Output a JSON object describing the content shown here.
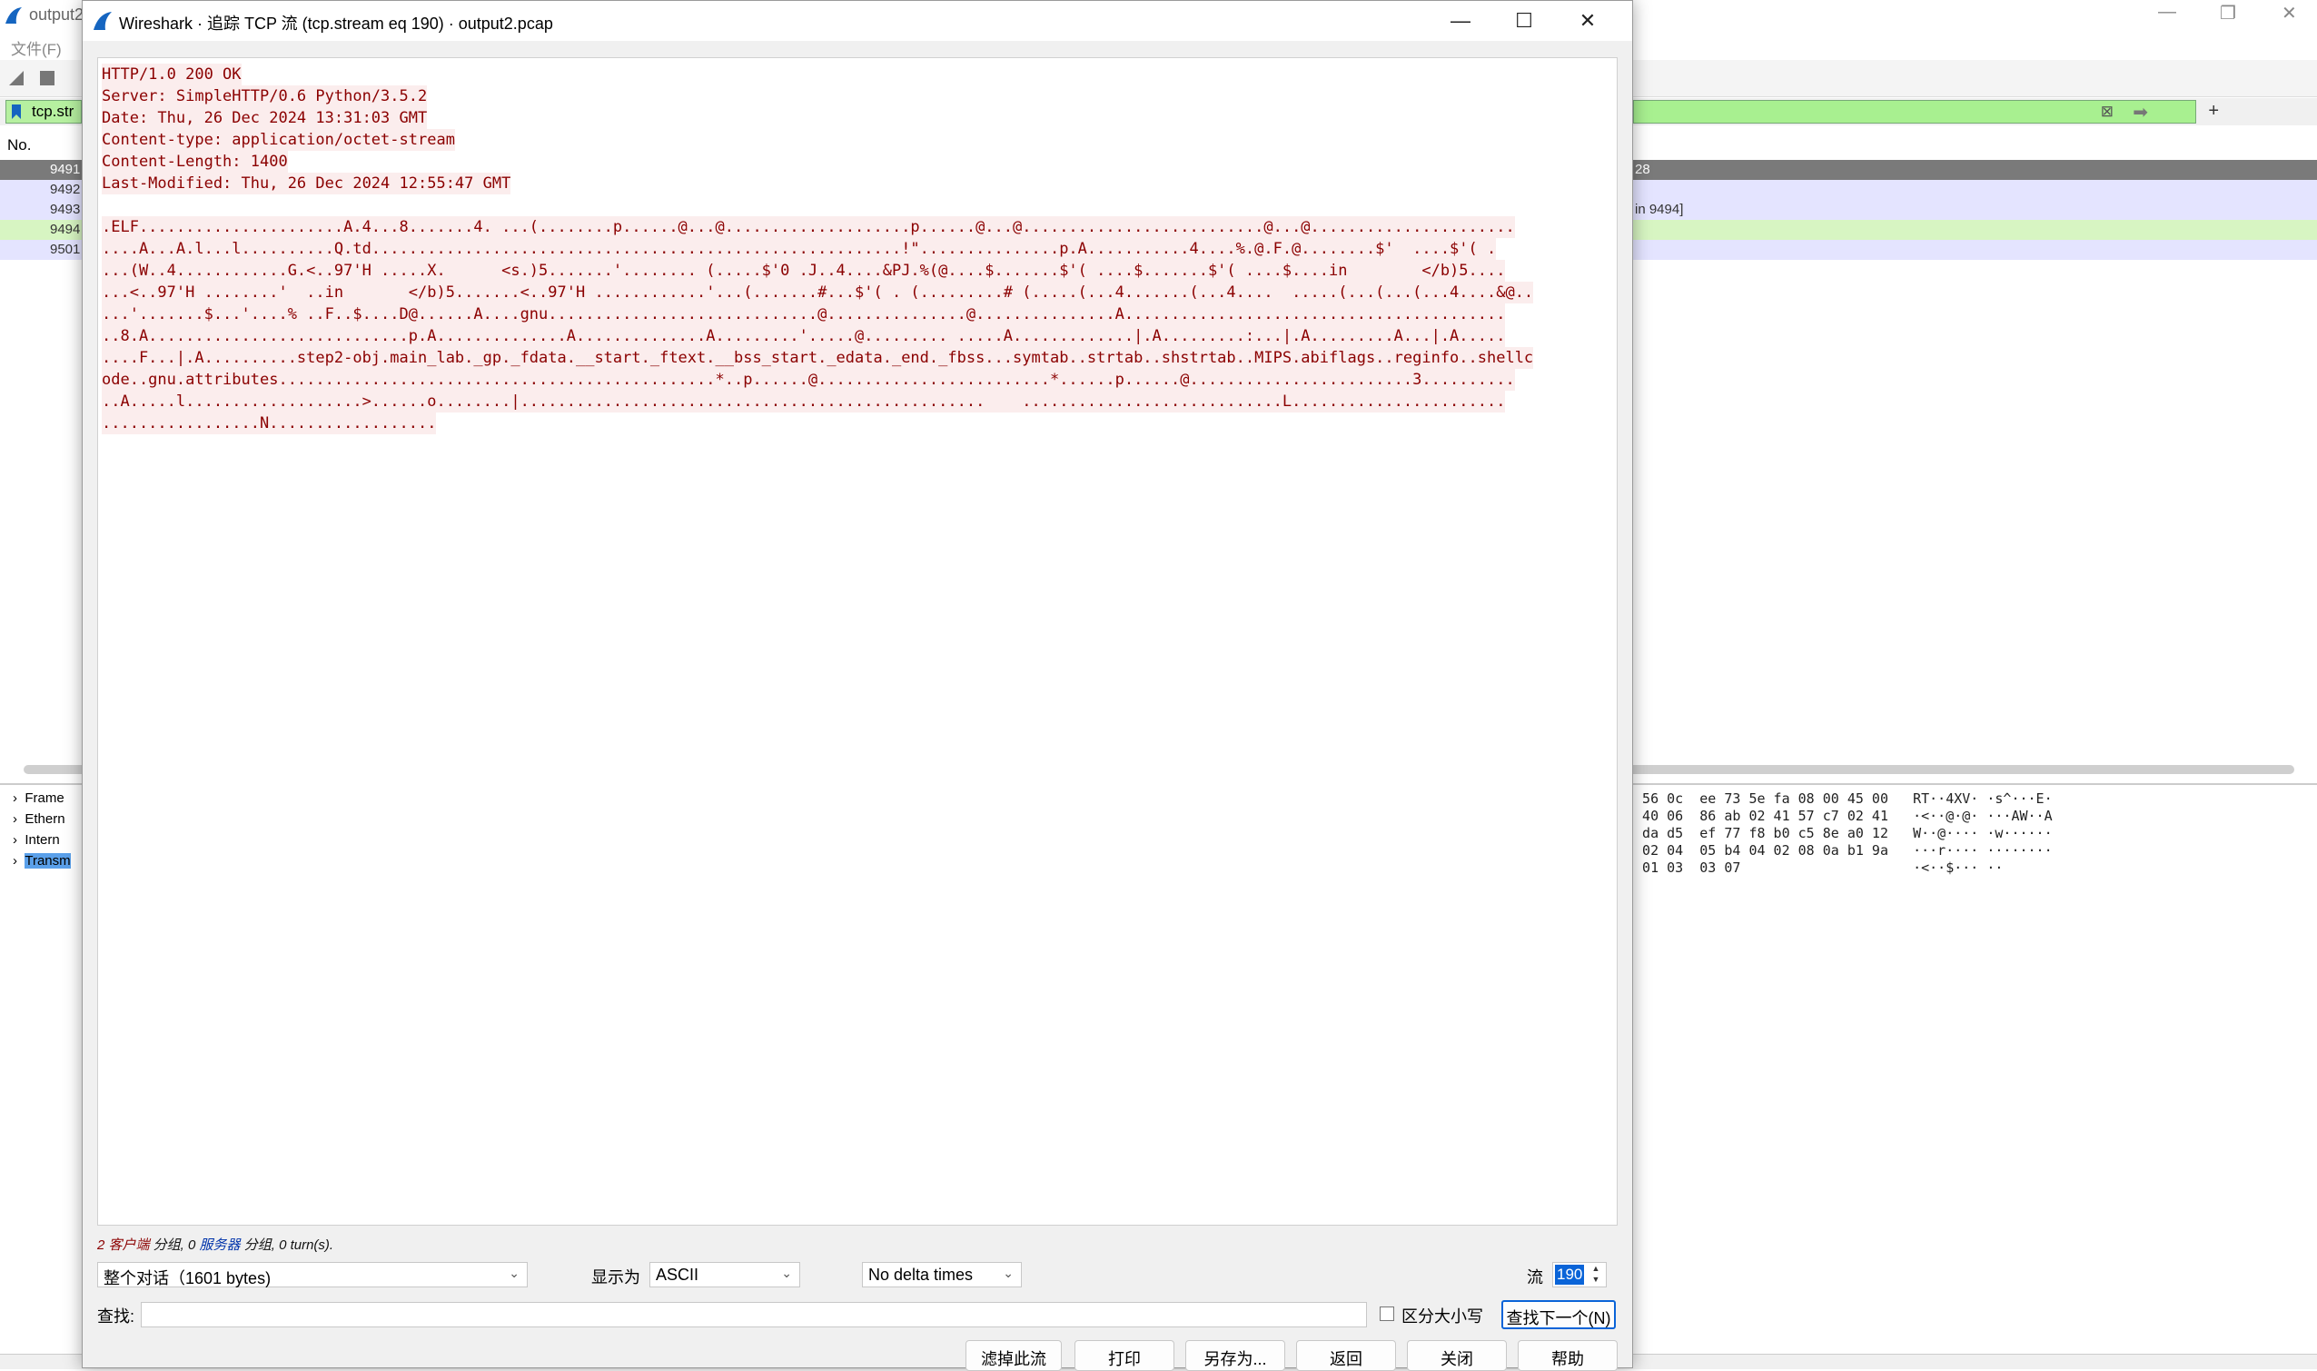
{
  "background_window": {
    "title": "output2",
    "menu": "文件(F)",
    "filter_text": "tcp.str",
    "list_header": "No.",
    "packets": [
      "9491",
      "9492",
      "9493",
      "9494",
      "9501"
    ],
    "row_right_1": "28",
    "row_right_3": "in 9494]",
    "tree_items": [
      "Frame",
      "Ethern",
      "Intern",
      "Transm"
    ],
    "hex_rows": [
      "3 56 0c  ee 73 5e fa 08 00 45 00   RT··4XV· ·s^···E·",
      ") 40 06  86 ab 02 41 57 c7 02 41   ·<··@·@· ···AW··A",
      "3 da d5  ef 77 f8 b0 c5 8e a0 12   W··@···· ·w······",
      ") 02 04  05 b4 04 02 08 0a b1 9a   ···r···· ········",
      "› 01 03  03 07                     ·<··$··· ··"
    ]
  },
  "dialog": {
    "title": "Wireshark · 追踪 TCP 流 (tcp.stream eq 190) · output2.pcap",
    "http_headers": [
      "HTTP/1.0 200 OK",
      "Server: SimpleHTTP/0.6 Python/3.5.2",
      "Date: Thu, 26 Dec 2024 13:31:03 GMT",
      "Content-type: application/octet-stream",
      "Content-Length: 1400",
      "Last-Modified: Thu, 26 Dec 2024 12:55:47 GMT"
    ],
    "binary_lines": [
      ".ELF......................A.4...8.......4. ...(........p......@...@....................p......@...@..........................@...@......................",
      "....A...A.l...l..........Q.td.........................................................!\"...............p.A...........4....%.@.F.@........$'  ....$'( .",
      "...(W..4............G.<..97'H .....X.      <s.)5.......'........ (.....$'0 .J..4....&PJ.%(@....$.......$'( ....$.......$'( ....$....in        </b)5....",
      "...<..97'H ........'  ..in       </b)5.......<..97'H ............'...(.......#...$'( . (.........# (.....(...4.......(...4....  .....(...(...(...4....&@..",
      "...'.......$...'....% ..F..$....D@......A....gnu.............................@...............@...............A.........................................",
      "..8.A............................p.A..............A..............A.........'.....@......... .....A.............|.A.........:...|.A.........A...|.A.....",
      "....F...|.A..........step2-obj.main_lab._gp._fdata.__start._ftext.__bss_start._edata._end._fbss...symtab..strtab..shstrtab..MIPS.abiflags..reginfo..shellc",
      "ode..gnu.attributes...............................................*..p......@.........................*......p......@........................3..........",
      "..A.....l...................>......o........|..................................................    ............................L.......................",
      ".................N.................."
    ],
    "summary_client": "2 客户端",
    "summary_text1": " 分组, ",
    "summary_zero": "0 ",
    "summary_server": "服务器",
    "summary_text2": " 分组, 0 turn(s).",
    "conversation_select": "整个对话（1601 bytes)",
    "show_as_label": "显示为",
    "show_as_value": "ASCII",
    "delta_value": "No delta times",
    "stream_label": "流",
    "stream_value": "190",
    "find_label": "查找:",
    "find_value": "",
    "case_label": "区分大小写",
    "find_next": "查找下一个(N)",
    "buttons": {
      "filter_out": "滤掉此流",
      "print": "打印",
      "save_as": "另存为...",
      "back": "返回",
      "close": "关闭",
      "help": "帮助"
    }
  },
  "colors": {
    "client_text": "#8b0000",
    "client_bg": "#fbeded",
    "accent": "#0a64d8",
    "filter_green": "#a8f090"
  }
}
